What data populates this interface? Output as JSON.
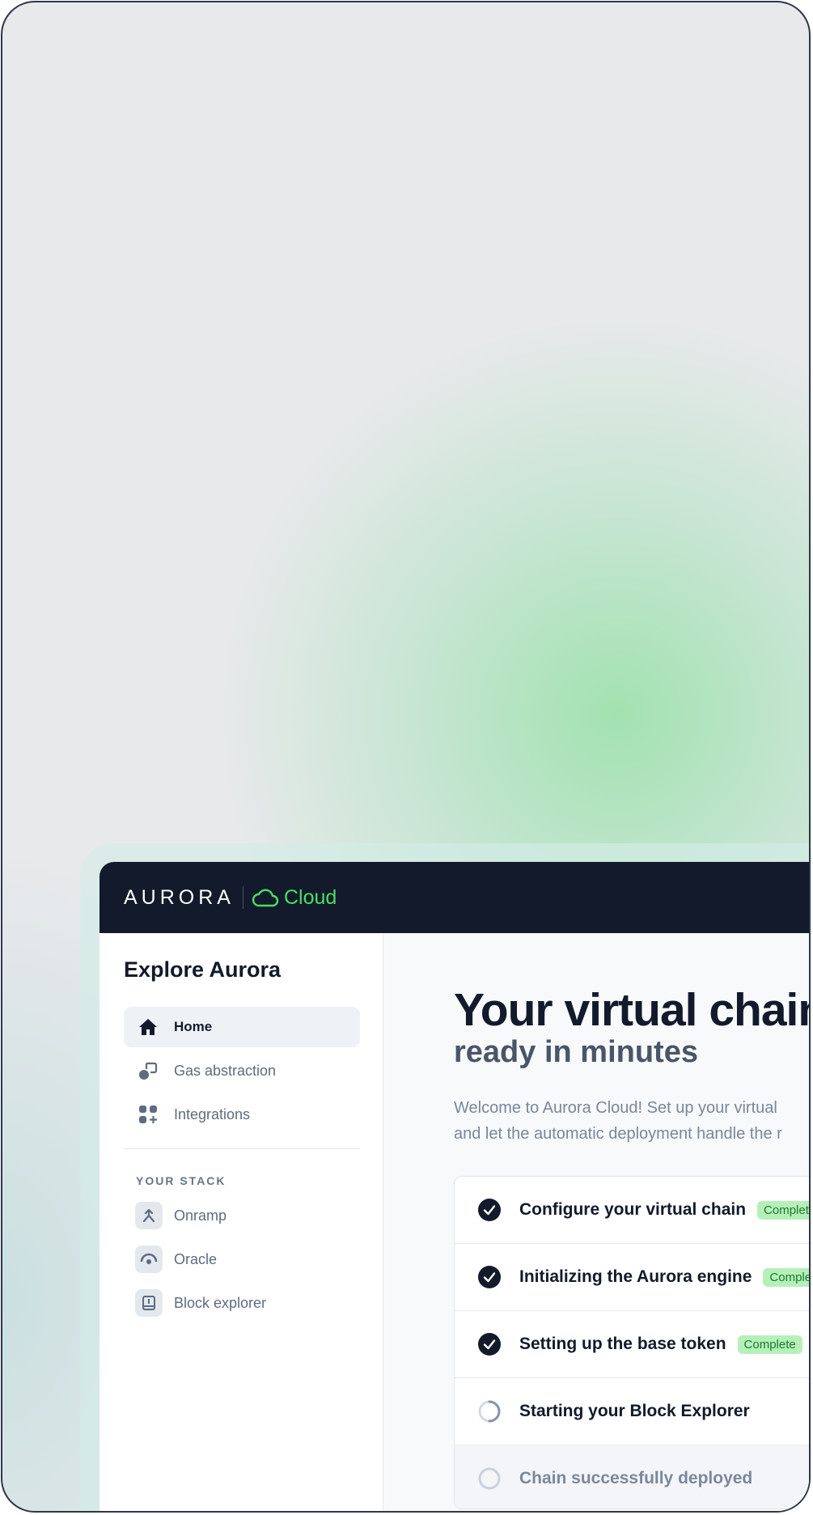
{
  "app": {
    "logo_text": "AURORA",
    "cloud_text": "Cloud"
  },
  "sidebar": {
    "title": "Explore Aurora",
    "nav": [
      {
        "label": "Home",
        "icon": "home-icon",
        "active": true
      },
      {
        "label": "Gas abstraction",
        "icon": "gas-abstraction-icon",
        "active": false
      },
      {
        "label": "Integrations",
        "icon": "integrations-icon",
        "active": false
      }
    ],
    "stack_label": "YOUR STACK",
    "stack": [
      {
        "label": "Onramp",
        "icon": "onramp-icon"
      },
      {
        "label": "Oracle",
        "icon": "oracle-icon"
      },
      {
        "label": "Block explorer",
        "icon": "block-explorer-icon"
      }
    ]
  },
  "main": {
    "title": "Your virtual chain,",
    "subtitle": "ready in minutes",
    "description_line1": "Welcome to Aurora Cloud! Set up your virtual",
    "description_line2": "and let the automatic deployment handle the r",
    "steps": [
      {
        "label": "Configure your virtual chain",
        "status": "Complete",
        "state": "done"
      },
      {
        "label": "Initializing the Aurora engine",
        "status": "Complete",
        "state": "done"
      },
      {
        "label": "Setting up the base token",
        "status": "Complete",
        "state": "done"
      },
      {
        "label": "Starting your Block Explorer",
        "status": "",
        "state": "loading"
      },
      {
        "label": "Chain successfully deployed",
        "status": "",
        "state": "pending"
      }
    ]
  },
  "colors": {
    "topbar": "#121a2b",
    "accent_green": "#4ade62",
    "badge_bg": "#b6f0b9",
    "badge_text": "#1a7a2a"
  }
}
